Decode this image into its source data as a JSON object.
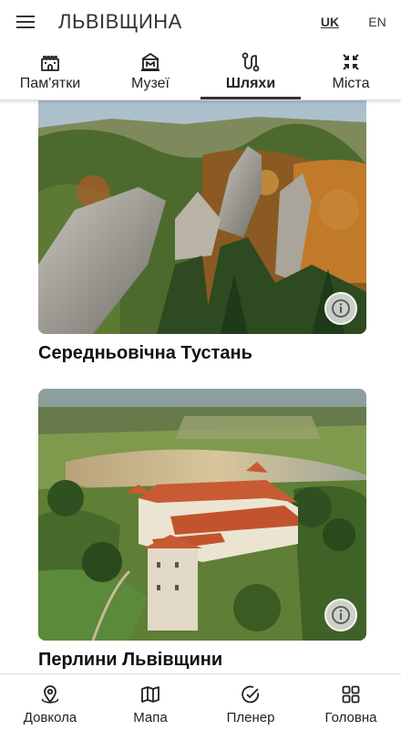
{
  "app": {
    "title": "ЛЬВІВЩИНА",
    "languages": [
      {
        "code": "UK",
        "active": true
      },
      {
        "code": "EN",
        "active": false
      }
    ]
  },
  "tabs": [
    {
      "label": "Пам'ятки",
      "icon": "castle-icon",
      "active": false
    },
    {
      "label": "Музеї",
      "icon": "museum-icon",
      "active": false
    },
    {
      "label": "Шляхи",
      "icon": "route-icon",
      "active": true
    },
    {
      "label": "Міста",
      "icon": "collapse-arrows-icon",
      "active": false
    }
  ],
  "cards": [
    {
      "title": "Середньовічна Тустань",
      "image": "rock-cliffs-autumn-forest-photo"
    },
    {
      "title": "Перлини Львівщини",
      "image": "castle-lake-aerial-photo"
    }
  ],
  "bottom_nav": [
    {
      "label": "Довкола",
      "icon": "location-around-icon"
    },
    {
      "label": "Мапа",
      "icon": "map-icon"
    },
    {
      "label": "Пленер",
      "icon": "check-circle-icon"
    },
    {
      "label": "Головна",
      "icon": "grid-icon"
    }
  ],
  "colors": {
    "text": "#1a1a1a",
    "active_indicator": "#333333",
    "background": "#ffffff"
  }
}
